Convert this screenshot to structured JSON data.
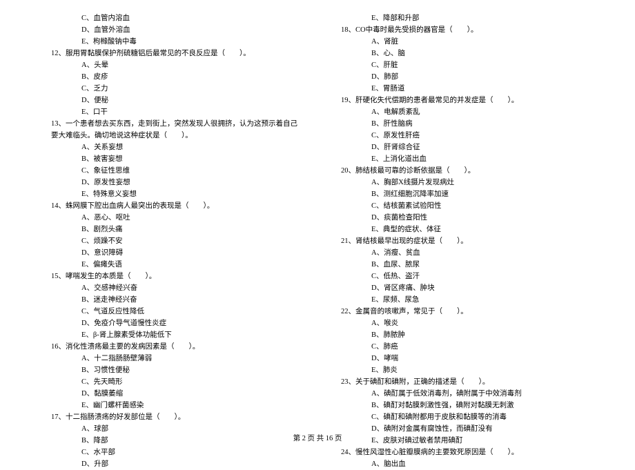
{
  "footer": "第 2 页 共 16 页",
  "left": {
    "preOpts": [
      "C、血管内溶血",
      "D、血管外溶血",
      "E、枸橼酸钠中毒"
    ],
    "questions": [
      {
        "num": "12、",
        "text": "服用胃黏膜保护剂硫糖铝后最常见的不良反应是（　　）。",
        "opts": [
          "A、头晕",
          "B、皮疹",
          "C、乏力",
          "D、便秘",
          "E、口干"
        ]
      },
      {
        "num": "13、",
        "text": "一个患者想去买东西，走到街上，突然发现人很拥挤，认为这预示着自己要大难临头。确切地说这种症状是（　　）。",
        "wrap": true,
        "opts": [
          "A、关系妄想",
          "B、被害妄想",
          "C、象征性思维",
          "D、原发性妄想",
          "E、特殊意义妄想"
        ]
      },
      {
        "num": "14、",
        "text": "蛛网膜下腔出血病人最突出的表现是（　　）。",
        "opts": [
          "A、恶心、呕吐",
          "B、剧烈头痛",
          "C、烦躁不安",
          "D、意识障碍",
          "E、偏瘫失语"
        ]
      },
      {
        "num": "15、",
        "text": "哮喘发生的本质是（　　）。",
        "opts": [
          "A、交感神经兴奋",
          "B、迷走神经兴奋",
          "C、气道反应性降低",
          "D、免疫介导气道慢性炎症",
          "E、β-肾上腺素受体功能低下"
        ]
      },
      {
        "num": "16、",
        "text": "消化性溃疡最主要的发病因素是（　　）。",
        "opts": [
          "A、十二指肠肠壁薄弱",
          "B、习惯性便秘",
          "C、先天畸形",
          "D、黏膜萎缩",
          "E、幽门螺杆菌感染"
        ]
      },
      {
        "num": "17、",
        "text": "十二指肠溃疡的好发部位是（　　）。",
        "opts": [
          "A、球部",
          "B、降部",
          "C、水平部",
          "D、升部"
        ]
      }
    ]
  },
  "right": {
    "preOpts": [
      "E、降部和升部"
    ],
    "questions": [
      {
        "num": "18、",
        "text": "CO中毒时最先受损的器官是（　　）。",
        "opts": [
          "A、肾脏",
          "B、心、脑",
          "C、肝脏",
          "D、肺部",
          "E、胃肠道"
        ]
      },
      {
        "num": "19、",
        "text": "肝硬化失代偿期的患者最常见的并发症是（　　）。",
        "opts": [
          "A、电解质紊乱",
          "B、肝性脑病",
          "C、原发性肝癌",
          "D、肝肾综合征",
          "E、上消化道出血"
        ]
      },
      {
        "num": "20、",
        "text": "肺结核最可靠的诊断依据是（　　）。",
        "opts": [
          "A、胸部X线摄片发现病灶",
          "B、测红细胞沉降率加速",
          "C、结核菌素试验阳性",
          "D、痰菌检查阳性",
          "E、典型的症状、体征"
        ]
      },
      {
        "num": "21、",
        "text": "肾结核最早出现的症状是（　　）。",
        "opts": [
          "A、消瘦、贫血",
          "B、血尿、脓尿",
          "C、低热、盗汗",
          "D、肾区疼痛、肿块",
          "E、尿频、尿急"
        ]
      },
      {
        "num": "22、",
        "text": "金属音的咳嗽声，常见于（　　）。",
        "opts": [
          "A、喉炎",
          "B、肺脓肿",
          "C、肺癌",
          "D、哮喘",
          "E、肺炎"
        ]
      },
      {
        "num": "23、",
        "text": "关于碘酊和碘附，正确的描述是（　　）。",
        "opts": [
          "A、碘酊属于低效消毒剂，碘附属于中效消毒剂",
          "B、碘酊对黏膜刺激性强，碘附对黏膜无刺激",
          "C、碘酊和碘附都用于皮肤和黏膜等的消毒",
          "D、碘附对金属有腐蚀性，而碘酊没有",
          "E、皮肤对碘过敏者禁用碘酊"
        ]
      },
      {
        "num": "24、",
        "text": "慢性风湿性心脏瓣膜病的主要致死原因是（　　）。",
        "opts": [
          "A、脑出血"
        ]
      }
    ]
  }
}
